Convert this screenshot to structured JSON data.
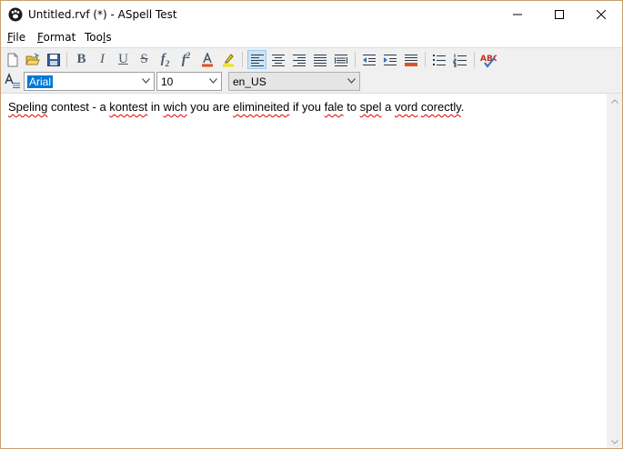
{
  "window": {
    "title": "Untitled.rvf (*) - ASpell Test"
  },
  "menu": {
    "file_mn": "F",
    "file_rest": "ile",
    "format_mn": "F",
    "format_rest": "ormat",
    "tools_pre": "Too",
    "tools_mn": "l",
    "tools_post": "s"
  },
  "toolbar": {
    "bold": "B",
    "italic": "I",
    "underline": "U",
    "strike": "S",
    "subscript_base": "f",
    "subscript_sub": "2",
    "superscript_base": "f",
    "superscript_sup": "2"
  },
  "format_bar": {
    "font_value": "Arial",
    "size_value": "10",
    "language_value": "en_US"
  },
  "document": {
    "words": [
      {
        "t": "Speling",
        "err": true
      },
      {
        "t": " contest - a ",
        "err": false
      },
      {
        "t": "kontest",
        "err": true
      },
      {
        "t": " in ",
        "err": false
      },
      {
        "t": "wich",
        "err": true
      },
      {
        "t": " you are ",
        "err": false
      },
      {
        "t": "elimineited",
        "err": true
      },
      {
        "t": " if you ",
        "err": false
      },
      {
        "t": "fale",
        "err": true
      },
      {
        "t": " to ",
        "err": false
      },
      {
        "t": "spel",
        "err": true
      },
      {
        "t": " a ",
        "err": false
      },
      {
        "t": "vord",
        "err": true
      },
      {
        "t": " ",
        "err": false
      },
      {
        "t": "corectly",
        "err": true
      },
      {
        "t": ".",
        "err": false
      }
    ]
  },
  "colors": {
    "accent": "#0078d7",
    "error_underline": "#e00000",
    "text_color_bar": "#e05020",
    "highlight_bar": "#f0e000"
  }
}
